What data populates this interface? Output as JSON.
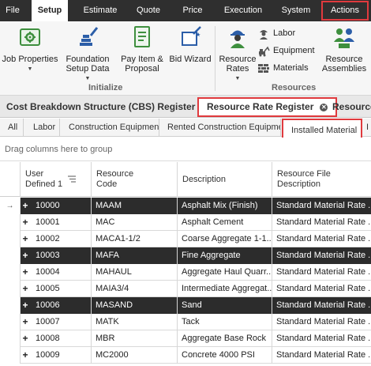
{
  "menu": {
    "items": [
      {
        "label": "File"
      },
      {
        "label": "Setup"
      },
      {
        "label": "Estimate"
      },
      {
        "label": "Quote"
      },
      {
        "label": "Price"
      },
      {
        "label": "Execution"
      },
      {
        "label": "System"
      },
      {
        "label": "Actions"
      }
    ],
    "active": "Setup",
    "highlighted": "Actions"
  },
  "ribbon": {
    "job_properties": "Job Properties",
    "foundation_setup_data": "Foundation Setup Data",
    "pay_item_proposal": "Pay Item & Proposal",
    "bid_wizard": "Bid Wizard",
    "resource_rates": "Resource Rates",
    "labor": "Labor",
    "equipment": "Equipment",
    "materials": "Materials",
    "resource_assemblies": "Resource Assemblies",
    "group_initialize": "Initialize",
    "group_resources": "Resources"
  },
  "doc_tabs": {
    "cbs_register": "Cost Breakdown Structure (CBS) Register",
    "resource_rate_register": "Resource Rate Register",
    "resource_truncated": "Resource"
  },
  "filter_tabs": {
    "items": [
      {
        "label": "All"
      },
      {
        "label": "Labor"
      },
      {
        "label": "Construction Equipment"
      },
      {
        "label": "Rented Construction Equipment"
      },
      {
        "label": "Installed Material"
      },
      {
        "label": "I"
      }
    ],
    "active": "Installed Material"
  },
  "group_panel": {
    "hint": "Drag columns here to group"
  },
  "grid": {
    "columns": [
      {
        "line1": "User",
        "line2": "Defined 1"
      },
      {
        "line1": "Resource",
        "line2": "Code"
      },
      {
        "line1": "Description",
        "line2": ""
      },
      {
        "line1": "Resource File",
        "line2": "Description"
      }
    ],
    "rows": [
      {
        "user_defined_1": "10000",
        "code": "MAAM",
        "description": "Asphalt Mix (Finish)",
        "file_description": "Standard Material Rate ...",
        "selected": true,
        "current": true
      },
      {
        "user_defined_1": "10001",
        "code": "MAC",
        "description": "Asphalt Cement",
        "file_description": "Standard Material Rate ...",
        "selected": false,
        "current": false
      },
      {
        "user_defined_1": "10002",
        "code": "MACA1-1/2",
        "description": "Coarse Aggregate 1-1...",
        "file_description": "Standard Material Rate ...",
        "selected": false,
        "current": false
      },
      {
        "user_defined_1": "10003",
        "code": "MAFA",
        "description": "Fine Aggregate",
        "file_description": "Standard Material Rate ...",
        "selected": true,
        "current": false
      },
      {
        "user_defined_1": "10004",
        "code": "MAHAUL",
        "description": "Aggregate Haul Quarr...",
        "file_description": "Standard Material Rate ...",
        "selected": false,
        "current": false
      },
      {
        "user_defined_1": "10005",
        "code": "MAIA3/4",
        "description": "Intermediate Aggregat...",
        "file_description": "Standard Material Rate ...",
        "selected": false,
        "current": false
      },
      {
        "user_defined_1": "10006",
        "code": "MASAND",
        "description": "Sand",
        "file_description": "Standard Material Rate ...",
        "selected": true,
        "current": false
      },
      {
        "user_defined_1": "10007",
        "code": "MATK",
        "description": "Tack",
        "file_description": "Standard Material Rate ...",
        "selected": false,
        "current": false
      },
      {
        "user_defined_1": "10008",
        "code": "MBR",
        "description": "Aggregate Base Rock",
        "file_description": "Standard Material Rate ...",
        "selected": false,
        "current": false
      },
      {
        "user_defined_1": "10009",
        "code": "MC2000",
        "description": "Concrete 4000 PSI",
        "file_description": "Standard Material Rate ...",
        "selected": false,
        "current": false
      }
    ]
  },
  "colors": {
    "menubar_bg": "#2f2f2f",
    "highlight_red": "#e03a3e",
    "selected_row_bg": "#2c2c2c",
    "icon_green": "#3e8f3e",
    "icon_blue": "#2c5ea8"
  },
  "icons": {
    "job_properties": "gear-folder-icon",
    "foundation_setup_data": "brush-stack-icon",
    "pay_item_proposal": "document-icon",
    "bid_wizard": "wand-icon",
    "resource_rates": "worker-icon",
    "labor": "worker-icon",
    "equipment": "excavator-icon",
    "materials": "bricks-icon",
    "resource_assemblies": "people-assembly-icon",
    "sort": "sort-ascending-icon",
    "row_pointer": "arrow-right-icon",
    "expand": "plus-icon",
    "close": "close-icon"
  }
}
